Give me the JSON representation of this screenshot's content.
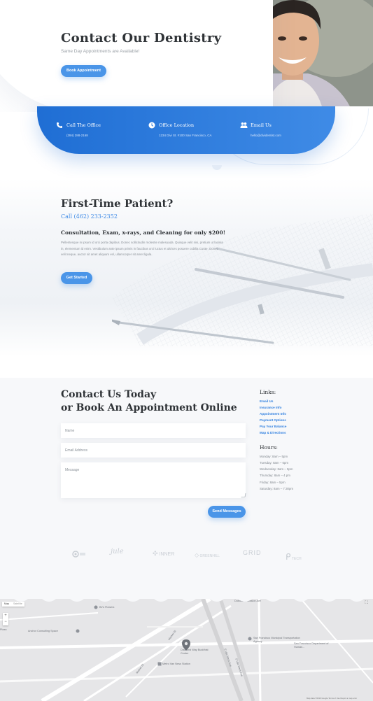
{
  "hero": {
    "title": "Contact Our Dentistry",
    "subtitle": "Same Day Appointments are Available!",
    "button_label": "Book Appointment"
  },
  "info_band": {
    "items": [
      {
        "icon": "phone-icon",
        "label": "Call The Office",
        "value": "(394) 288-2168"
      },
      {
        "icon": "clock-icon",
        "label": "Office Location",
        "value": "1234 Divi St. #100 San Francisco, CA"
      },
      {
        "icon": "people-icon",
        "label": "Email Us",
        "value": "hello@dividentist.com"
      }
    ]
  },
  "first_time": {
    "title": "First-Time Patient?",
    "phone": "Call (462) 233-2352",
    "offer": "Consultation, Exam, x-rays, and Cleaning for only $200!",
    "body": "Pellentesque in ipsum id orci porta dapibus. Donec sollicitudin molestie malesuada. Quisque velit nisi, pretium ut lacinia in, elementum id enim. Vestibulum ante ipsum primis in faucibus orci luctus et ultrices posuere cubilia Curae; Donec velit neque, auctor sit amet aliquam vel, ullamcorper sit amet ligula.",
    "button_label": "Get Started"
  },
  "contact": {
    "title_line1": "Contact Us Today",
    "title_line2": "or Book An Appointment Online",
    "name_placeholder": "Name",
    "email_placeholder": "Email Address",
    "message_placeholder": "Message",
    "send_label": "Send Messages"
  },
  "links": {
    "heading": "Links:",
    "items": [
      "Email Us",
      "Insurance Info",
      "Appointment Info",
      "Payment Options",
      "Pay Your Balance",
      "Map & Directions"
    ]
  },
  "hours": {
    "heading": "Hours:",
    "items": [
      "Monday: 8am – 5pm",
      "Tuesday: 8am – 6pm",
      "Wednesday: 8am – 5pm",
      "Thursday: 8am – 4 pm",
      "Friday: 8am – 5pm",
      "Saturday: 8am – 7:30pm"
    ]
  },
  "logos": [
    "jule",
    "INNER",
    "GREENHILL",
    "GRID",
    "TECH"
  ],
  "map": {
    "tab_map": "Map",
    "tab_satellite": "Satellite",
    "labels": {
      "bi_flowers": "BJ's Flowers",
      "anchor": "Anchor Consulting Space",
      "diamond": "Diamond Way Buddhist Center",
      "metro": "Metro Van Ness Station",
      "sfmta": "San Francisco Municipal Transportation Agency",
      "sf_dept": "San Francisco Department of Human...",
      "market_st": "Market St",
      "market_st2": "Market St",
      "s_van_ness": "S Van Ness Ave",
      "s_van_ness2": "S Van Ness Ave",
      "plaza": "Plaza",
      "top_street": "Duboce & Mission Ave"
    },
    "footer": "Map data ©2019 Google   Terms of Use   Report a map error"
  },
  "colors": {
    "accent": "#4a95e8",
    "band_start": "#1f6ed4",
    "band_end": "#3f8be6",
    "heading": "#2f3337"
  }
}
